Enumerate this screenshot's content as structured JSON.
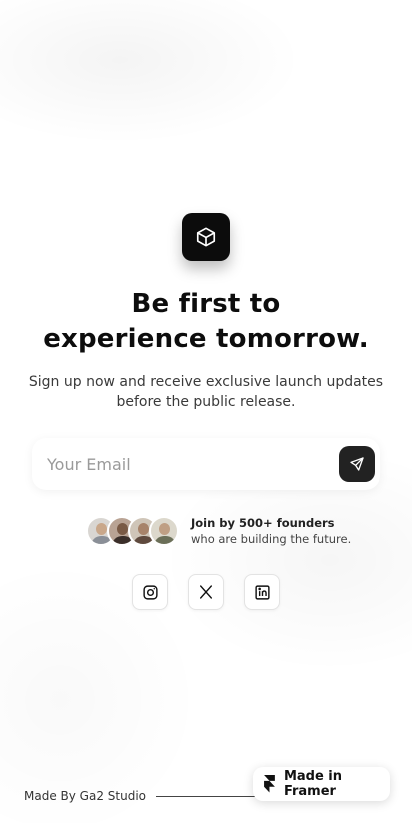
{
  "headline": {
    "line1": "Be first to",
    "line2": "experience tomorrow."
  },
  "subtext": "Sign up now and receive exclusive launch updates before the public release.",
  "email": {
    "placeholder": "Your Email",
    "value": ""
  },
  "founders": {
    "title": "Join by 500+ founders",
    "subtitle": "who are building the future."
  },
  "socials": [
    "instagram-icon",
    "x-icon",
    "linkedin-icon"
  ],
  "footer": {
    "credit": "Made By Ga2 Studio"
  },
  "framer_badge": {
    "label": "Made in Framer"
  },
  "colors": {
    "primary": "#0c0c0c",
    "send_button": "#222222",
    "background": "#ffffff"
  }
}
